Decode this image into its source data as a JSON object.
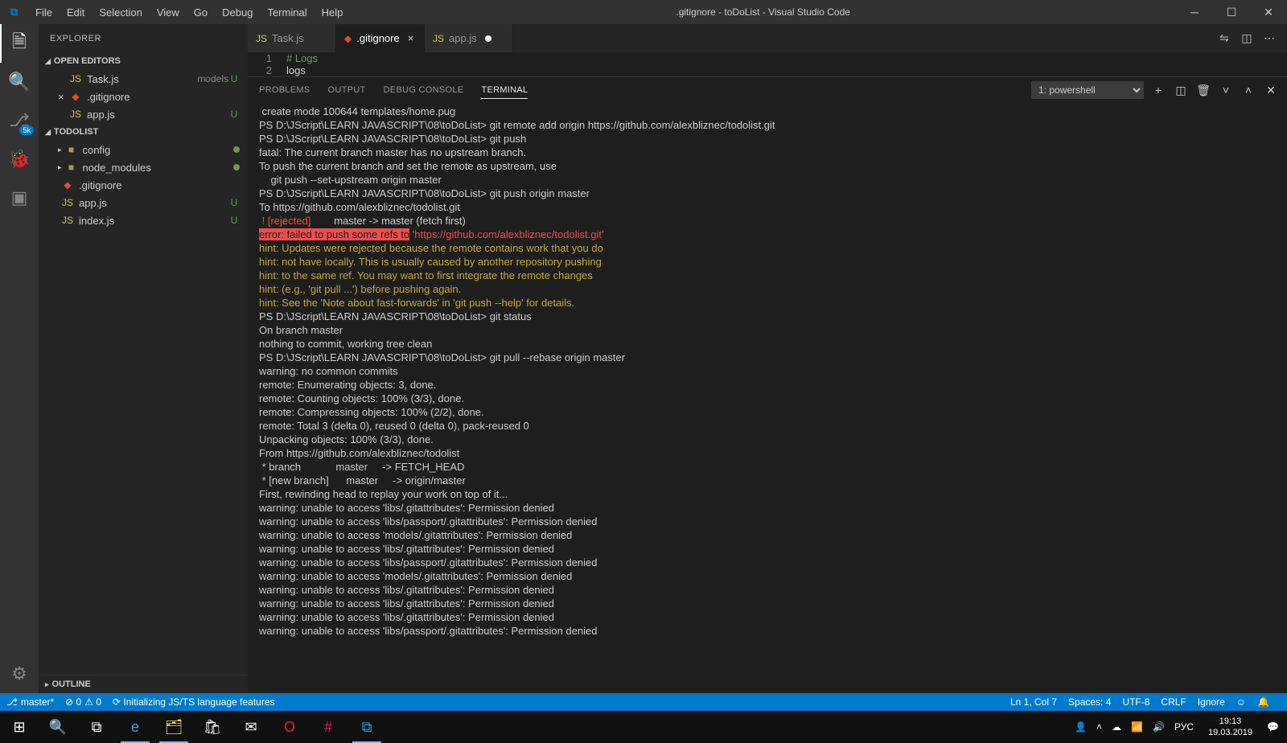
{
  "title_bar": {
    "menu": [
      "File",
      "Edit",
      "Selection",
      "View",
      "Go",
      "Debug",
      "Terminal",
      "Help"
    ],
    "title": ".gitignore - toDoList - Visual Studio Code"
  },
  "activity_badge": "5k",
  "sidebar": {
    "header": "EXPLORER",
    "sections": {
      "open_editors": "OPEN EDITORS",
      "project": "TODOLIST",
      "outline": "OUTLINE"
    },
    "open_editors_items": [
      {
        "icon": "JS",
        "icon_cls": "js-col",
        "label": "Task.js",
        "sub": "models",
        "status": "U"
      },
      {
        "icon": "◆",
        "icon_cls": "git-col",
        "label": ".gitignore",
        "sub": "",
        "status": "",
        "close": true
      },
      {
        "icon": "JS",
        "icon_cls": "js-col",
        "label": "app.js",
        "sub": "",
        "status": "U"
      }
    ],
    "tree": [
      {
        "tw": "▸",
        "icon": "■",
        "icon_cls": "fold-col",
        "label": "config",
        "dot": true
      },
      {
        "tw": "▸",
        "icon": "■",
        "icon_cls": "fold-col",
        "label": "node_modules",
        "dot": true
      },
      {
        "tw": "",
        "icon": "◆",
        "icon_cls": "git-col",
        "label": ".gitignore"
      },
      {
        "tw": "",
        "icon": "JS",
        "icon_cls": "js-col",
        "label": "app.js",
        "status": "U"
      },
      {
        "tw": "",
        "icon": "JS",
        "icon_cls": "js-col",
        "label": "index.js",
        "status": "U"
      }
    ]
  },
  "tabs": [
    {
      "icon": "JS",
      "icon_cls": "js-col",
      "label": "Task.js",
      "active": false,
      "dirty": false,
      "close": false
    },
    {
      "icon": "◆",
      "icon_cls": "git-col",
      "label": ".gitignore",
      "active": true,
      "dirty": false,
      "close": true
    },
    {
      "icon": "JS",
      "icon_cls": "js-col",
      "label": "app.js",
      "active": false,
      "dirty": true,
      "close": false
    }
  ],
  "editor_lines": [
    {
      "n": "1",
      "text": "# Logs",
      "cls": "cmt"
    },
    {
      "n": "2",
      "text": "logs",
      "cls": "plain"
    }
  ],
  "panel": {
    "tabs": [
      "PROBLEMS",
      "OUTPUT",
      "DEBUG CONSOLE",
      "TERMINAL"
    ],
    "active_tab": 3,
    "select_label": "1: powershell"
  },
  "terminal_lines": [
    {
      "t": " create mode 100644 templates/home.pug"
    },
    {
      "t": "PS D:\\JScript\\LEARN JAVASCRIPT\\08\\toDoList> git remote add origin https://github.com/alexbliznec/todolist.git"
    },
    {
      "t": "PS D:\\JScript\\LEARN JAVASCRIPT\\08\\toDoList> git push"
    },
    {
      "t": "fatal: The current branch master has no upstream branch."
    },
    {
      "t": "To push the current branch and set the remote as upstream, use"
    },
    {
      "t": ""
    },
    {
      "t": "    git push --set-upstream origin master"
    },
    {
      "t": ""
    },
    {
      "t": "PS D:\\JScript\\LEARN JAVASCRIPT\\08\\toDoList> git push origin master"
    },
    {
      "t": "To https://github.com/alexbliznec/todolist.git"
    },
    {
      "seg": [
        {
          "c": "red",
          "t": " ! [rejected]        "
        },
        {
          "t": "master -> master (fetch first)"
        }
      ]
    },
    {
      "seg": [
        {
          "c": "redbg",
          "t": "error: failed to push some refs to"
        },
        {
          "t": " "
        },
        {
          "c": "red",
          "t": "'https://github.com/alexbliznec/todolist.git'"
        }
      ]
    },
    {
      "c": "yel",
      "t": "hint: Updates were rejected because the remote contains work that you do"
    },
    {
      "c": "yel",
      "t": "hint: not have locally. This is usually caused by another repository pushing"
    },
    {
      "c": "yel",
      "t": "hint: to the same ref. You may want to first integrate the remote changes"
    },
    {
      "c": "yel",
      "t": "hint: (e.g., 'git pull ...') before pushing again."
    },
    {
      "c": "yel",
      "t": "hint: See the 'Note about fast-forwards' in 'git push --help' for details."
    },
    {
      "t": "PS D:\\JScript\\LEARN JAVASCRIPT\\08\\toDoList> git status"
    },
    {
      "t": "On branch master"
    },
    {
      "t": "nothing to commit, working tree clean"
    },
    {
      "t": "PS D:\\JScript\\LEARN JAVASCRIPT\\08\\toDoList> git pull --rebase origin master"
    },
    {
      "t": "warning: no common commits"
    },
    {
      "t": "remote: Enumerating objects: 3, done."
    },
    {
      "t": "remote: Counting objects: 100% (3/3), done."
    },
    {
      "t": "remote: Compressing objects: 100% (2/2), done."
    },
    {
      "t": "remote: Total 3 (delta 0), reused 0 (delta 0), pack-reused 0"
    },
    {
      "t": "Unpacking objects: 100% (3/3), done."
    },
    {
      "t": "From https://github.com/alexbliznec/todolist"
    },
    {
      "t": " * branch            master     -> FETCH_HEAD"
    },
    {
      "t": " * [new branch]      master     -> origin/master"
    },
    {
      "t": "First, rewinding head to replay your work on top of it..."
    },
    {
      "t": "warning: unable to access 'libs/.gitattributes': Permission denied"
    },
    {
      "t": "warning: unable to access 'libs/passport/.gitattributes': Permission denied"
    },
    {
      "t": "warning: unable to access 'models/.gitattributes': Permission denied"
    },
    {
      "t": "warning: unable to access 'libs/.gitattributes': Permission denied"
    },
    {
      "t": "warning: unable to access 'libs/passport/.gitattributes': Permission denied"
    },
    {
      "t": "warning: unable to access 'models/.gitattributes': Permission denied"
    },
    {
      "t": "warning: unable to access 'libs/.gitattributes': Permission denied"
    },
    {
      "t": "warning: unable to access 'libs/.gitattributes': Permission denied"
    },
    {
      "t": "warning: unable to access 'libs/.gitattributes': Permission denied"
    },
    {
      "t": "warning: unable to access 'libs/passport/.gitattributes': Permission denied"
    }
  ],
  "statusbar": {
    "branch": "master*",
    "errors": "⊘ 0",
    "warnings": "⚠ 0",
    "sync": "⟳ Initializing JS/TS language features",
    "line": "Ln 1, Col 7",
    "spaces": "Spaces: 4",
    "enc": "UTF-8",
    "eol": "CRLF",
    "lang": "Ignore",
    "smile": "☺",
    "bell": "🔔"
  },
  "taskbar": {
    "time": "19:13",
    "date": "19.03.2019",
    "lang": "РУС"
  }
}
